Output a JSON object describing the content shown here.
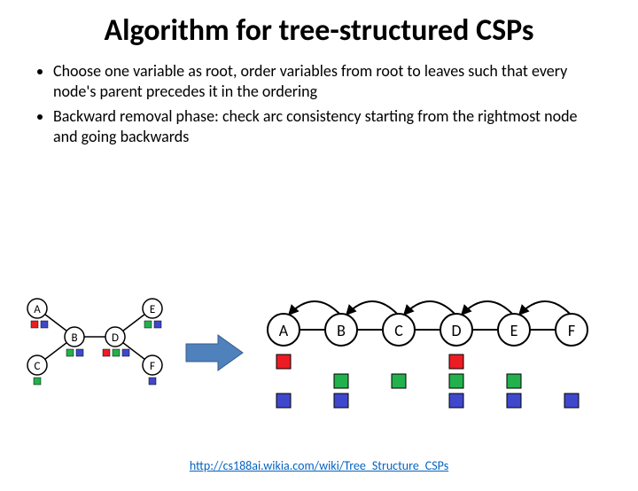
{
  "title": "Algorithm for tree-structured CSPs",
  "bullets": [
    "Choose one variable as root, order variables from root to leaves such that every node's parent precedes it in the ordering",
    "Backward removal phase: check arc consistency starting from the rightmost node and going backwards"
  ],
  "tree": {
    "nodes": {
      "A": "A",
      "B": "B",
      "C": "C",
      "D": "D",
      "E": "E",
      "F": "F"
    }
  },
  "linear": {
    "nodes": [
      "A",
      "B",
      "C",
      "D",
      "E",
      "F"
    ]
  },
  "colors": {
    "red": "#ed1c24",
    "green": "#22b14c",
    "blue": "#3f48cc"
  },
  "source": {
    "label": "http://cs188ai.wikia.com/wiki/Tree_Structure_CSPs",
    "href": "http://cs188ai.wikia.com/wiki/Tree_Structure_CSPs"
  }
}
